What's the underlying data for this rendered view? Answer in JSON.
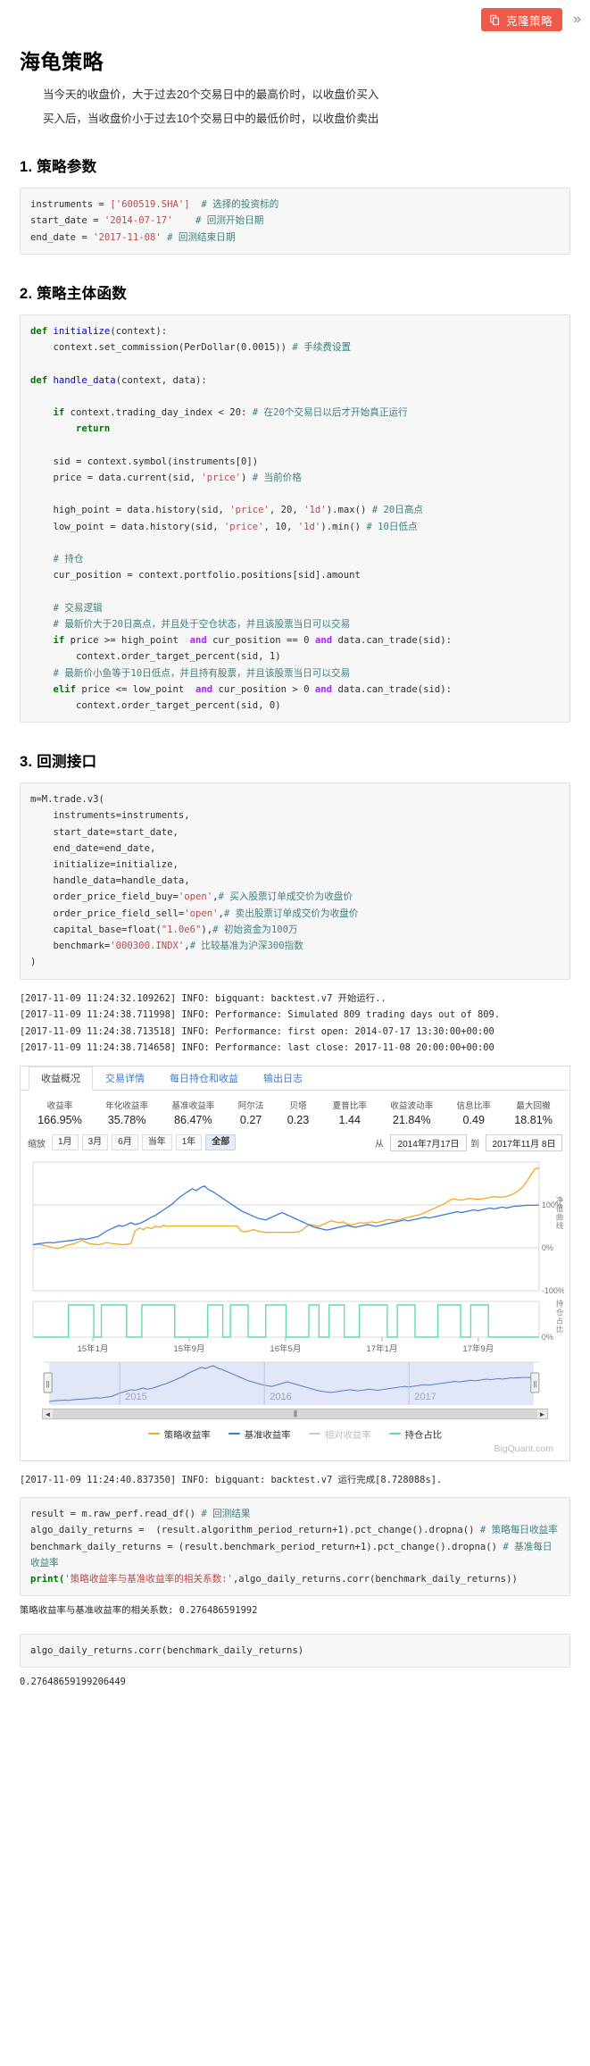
{
  "topbar": {
    "clone_label": "克隆策略",
    "clone_icon": "copy-icon",
    "expand_icon": "»",
    "accent_color": "#ee5a47"
  },
  "header": {
    "title": "海龟策略",
    "desc_line1": "当今天的收盘价，大于过去20个交易日中的最高价时，以收盘价买入",
    "desc_line2": "买入后，当收盘价小于过去10个交易日中的最低价时，以收盘价卖出"
  },
  "sections": {
    "params_heading": "1. 策略参数",
    "body_heading": "2. 策略主体函数",
    "api_heading": "3. 回测接口"
  },
  "code_params": {
    "l1_name": "instruments",
    "l1_val": "['600519.SHA']",
    "l1_cmt": "# 选择的投资标的",
    "l2_name": "start_date",
    "l2_val": "'2014-07-17'",
    "l2_cmt": "# 回测开始日期",
    "l3_name": "end_date",
    "l3_val": "'2017-11-08'",
    "l3_cmt": "# 回测结束日期"
  },
  "code_body": {
    "def1": "def",
    "fn1": "initialize",
    "sig1": "(context):",
    "l2": "    context.set_commission(PerDollar(0.0015))",
    "c2": "# 手续费设置",
    "def2": "def",
    "fn2": "handle_data",
    "sig2": "(context, data):",
    "if1": "if",
    "if1_rest": " context.trading_day_index < 20:",
    "c3": "# 在20个交易日以后才开始真正运行",
    "ret": "return",
    "l_sid": "    sid = context.symbol(instruments[0])",
    "l_price_a": "    price = data.current(sid, ",
    "l_price_str": "'price'",
    "l_price_b": ") ",
    "c4": "# 当前价格",
    "l_high_a": "    high_point = data.history(sid, ",
    "l_high_str": "'price'",
    "l_high_b": ", 20, ",
    "l_high_str2": "'1d'",
    "l_high_c": ").max() ",
    "c5": "# 20日高点",
    "l_low_a": "    low_point = data.history(sid, ",
    "l_low_str": "'price'",
    "l_low_b": ", 10, ",
    "l_low_str2": "'1d'",
    "l_low_c": ").min() ",
    "c6": "# 10日低点",
    "c7": "# 持仓",
    "l_pos": "    cur_position = context.portfolio.positions[sid].amount",
    "c8": "# 交易逻辑",
    "c9": "# 最新价大于20日高点，并且处于空仓状态，并且该股票当日可以交易",
    "if2": "if",
    "if2_a": " price >= high_point  ",
    "and1": "and",
    "if2_b": " cur_position == 0 ",
    "and2": "and",
    "if2_c": " data.can_trade(sid):",
    "l_buy": "        context.order_target_percent(sid, 1)",
    "c10": "# 最新价小鱼等于10日低点，并且持有股票，并且该股票当日可以交易",
    "elif": "elif",
    "elif_a": " price <= low_point  ",
    "and3": "and",
    "elif_b": " cur_position > 0 ",
    "and4": "and",
    "elif_c": " data.can_trade(sid):",
    "l_sell": "        context.order_target_percent(sid, 0)"
  },
  "code_api": {
    "l1": "m=M.trade.v3(",
    "l2": "    instruments=instruments,",
    "l3": "    start_date=start_date,",
    "l4": "    end_date=end_date,",
    "l5": "    initialize=initialize,",
    "l6": "    handle_data=handle_data,",
    "l7a": "    order_price_field_buy=",
    "l7s": "'open'",
    "l7b": ",",
    "l7c": "# 买入股票订单成交价为收盘价",
    "l8a": "    order_price_field_sell=",
    "l8s": "'open'",
    "l8b": ",",
    "l8c": "# 卖出股票订单成交价为收盘价",
    "l9a": "    capital_base=float(",
    "l9s": "\"1.0e6\"",
    "l9b": "),",
    "l9c": "# 初始资金为100万",
    "l10a": "    benchmark=",
    "l10s": "'000300.INDX'",
    "l10b": ",",
    "l10c": "# 比较基准为沪深300指数",
    "l11": ")"
  },
  "logs": {
    "run": "[2017-11-09 11:24:32.109262] INFO: bigquant: backtest.v7 开始运行..\n[2017-11-09 11:24:38.711998] INFO: Performance: Simulated 809 trading days out of 809.\n[2017-11-09 11:24:38.713518] INFO: Performance: first open: 2014-07-17 13:30:00+00:00\n[2017-11-09 11:24:38.714658] INFO: Performance: last close: 2017-11-08 20:00:00+00:00",
    "done": "[2017-11-09 11:24:40.837350] INFO: bigquant: backtest.v7 运行完成[8.728088s]."
  },
  "result_panel": {
    "tabs": [
      {
        "label": "收益概况",
        "active": true
      },
      {
        "label": "交易详情",
        "active": false
      },
      {
        "label": "每日持仓和收益",
        "active": false
      },
      {
        "label": "输出日志",
        "active": false
      }
    ],
    "metrics": [
      {
        "label": "收益率",
        "value": "166.95%"
      },
      {
        "label": "年化收益率",
        "value": "35.78%"
      },
      {
        "label": "基准收益率",
        "value": "86.47%"
      },
      {
        "label": "阿尔法",
        "value": "0.27"
      },
      {
        "label": "贝塔",
        "value": "0.23"
      },
      {
        "label": "夏普比率",
        "value": "1.44"
      },
      {
        "label": "收益波动率",
        "value": "21.84%"
      },
      {
        "label": "信息比率",
        "value": "0.49"
      },
      {
        "label": "最大回撤",
        "value": "18.81%"
      }
    ],
    "zoom_label": "缩放",
    "zoom_buttons": [
      {
        "label": "1月",
        "selected": false
      },
      {
        "label": "3月",
        "selected": false
      },
      {
        "label": "6月",
        "selected": false
      },
      {
        "label": "当年",
        "selected": false
      },
      {
        "label": "1年",
        "selected": false
      },
      {
        "label": "全部",
        "selected": true
      }
    ],
    "from_label": "从",
    "from_value": "2014年7月17日",
    "to_label": "到",
    "to_value": "2017年11月 8日",
    "y_axis_main": "净值曲线",
    "y_axis_sub": "持仓占比",
    "legend": [
      {
        "label": "策略收益率",
        "color": "#f5a623",
        "dim": false
      },
      {
        "label": "基准收益率",
        "color": "#3a7bd5",
        "dim": false
      },
      {
        "label": "相对收益率",
        "color": "#cccccc",
        "dim": true
      },
      {
        "label": "持仓占比",
        "color": "#5fe0a0",
        "dim": false
      }
    ],
    "brand": "BigQuant.com",
    "scroll_left_icon": "◄",
    "scroll_right_icon": "►",
    "scroll_grip_icon": "|||"
  },
  "chart_data": {
    "type": "line",
    "title": "",
    "xlabel": "",
    "ylabel": "净值曲线",
    "ylim": [
      -100,
      180
    ],
    "yticks": [
      "100%",
      "0%",
      "-100%"
    ],
    "xticks": [
      "15年1月",
      "15年9月",
      "16年5月",
      "17年1月",
      "17年9月"
    ],
    "grid": true,
    "legend_position": "bottom",
    "series": [
      {
        "name": "策略收益率",
        "color": "#f5a623",
        "values": [
          0,
          1,
          0,
          -2,
          -4,
          -7,
          -8,
          -6,
          -2,
          0,
          2,
          6,
          10,
          5,
          2,
          1,
          0,
          2,
          5,
          3,
          2,
          1,
          0,
          1,
          3,
          30,
          36,
          33,
          38,
          35,
          40,
          38,
          42,
          40,
          41,
          41,
          41,
          41,
          41,
          41,
          41,
          41,
          41,
          41,
          41,
          41,
          41,
          41,
          41,
          41,
          41,
          30,
          28,
          30,
          33,
          30,
          28,
          27,
          27,
          27,
          27,
          27,
          27,
          27,
          27,
          28,
          32,
          40,
          44,
          42,
          40,
          44,
          48,
          52,
          50,
          48,
          50,
          45,
          43,
          45,
          48,
          47,
          48,
          50,
          48,
          50,
          52,
          55,
          54,
          53,
          55,
          58,
          60,
          62,
          64,
          66,
          70,
          74,
          78,
          82,
          86,
          90,
          96,
          100,
          98,
          97,
          99,
          101,
          100,
          99,
          100,
          101,
          103,
          105,
          104,
          104,
          105,
          108,
          112,
          118,
          126,
          138,
          152,
          165,
          166.95
        ]
      },
      {
        "name": "基准收益率",
        "color": "#3a7bd5",
        "values": [
          0,
          2,
          3,
          4,
          5,
          4,
          6,
          7,
          8,
          9,
          10,
          12,
          13,
          12,
          14,
          16,
          18,
          24,
          30,
          34,
          38,
          42,
          40,
          44,
          48,
          44,
          46,
          50,
          55,
          60,
          64,
          70,
          76,
          82,
          88,
          96,
          104,
          110,
          116,
          122,
          118,
          124,
          128,
          120,
          116,
          110,
          104,
          98,
          92,
          86,
          80,
          74,
          70,
          66,
          62,
          58,
          56,
          54,
          58,
          62,
          66,
          70,
          66,
          62,
          58,
          54,
          50,
          46,
          42,
          38,
          36,
          34,
          32,
          34,
          36,
          38,
          40,
          42,
          40,
          38,
          40,
          42,
          44,
          42,
          40,
          42,
          44,
          46,
          48,
          50,
          52,
          54,
          52,
          54,
          56,
          58,
          60,
          58,
          60,
          62,
          64,
          66,
          68,
          70,
          72,
          70,
          72,
          74,
          76,
          74,
          76,
          78,
          80,
          78,
          80,
          82,
          80,
          82,
          84,
          84,
          85,
          86,
          86,
          86,
          86.47
        ]
      }
    ],
    "position_series": {
      "name": "持仓占比",
      "color": "#5fe0a0",
      "ylabel": "持仓占比",
      "yticks": [
        "0%"
      ],
      "segments": [
        [
          0.07,
          0.12
        ],
        [
          0.135,
          0.185
        ],
        [
          0.215,
          0.28
        ],
        [
          0.345,
          0.375
        ],
        [
          0.39,
          0.425
        ],
        [
          0.46,
          0.5
        ],
        [
          0.545,
          0.565
        ],
        [
          0.585,
          0.615
        ],
        [
          0.645,
          0.7
        ],
        [
          0.72,
          0.755
        ],
        [
          0.8,
          0.845
        ],
        [
          0.865,
          0.9
        ]
      ]
    },
    "navigator": {
      "years": [
        "2015",
        "2016",
        "2017"
      ],
      "selection": [
        0.0,
        1.0
      ]
    }
  },
  "code_corr": {
    "l1a": "result = m.raw_perf.read_df() ",
    "l1c": "# 回测结果",
    "l2": "algo_daily_returns =  (result.algorithm_period_return+1).pct_change().dropna()",
    "l2c": "# 策略每日收益率",
    "l3": "benchmark_daily_returns = (result.benchmark_period_return+1).pct_change().dropna()",
    "l3c": "# 基准每日收益率",
    "l4a": "print(",
    "l4s": "'策略收益率与基准收益率的相关系数:'",
    "l4b": ",algo_daily_returns.corr(benchmark_daily_returns))"
  },
  "corr_output": "策略收益率与基准收益率的相关系数: 0.276486591992",
  "code_corr2": "algo_daily_returns.corr(benchmark_daily_returns)",
  "corr_output2": "0.27648659199206449"
}
